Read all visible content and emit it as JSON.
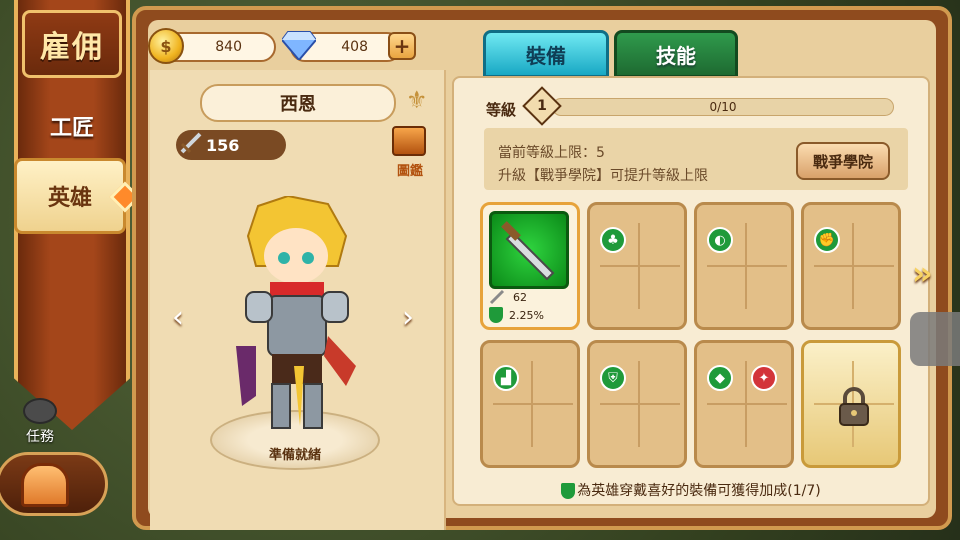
{
  "left_nav": {
    "title": "雇佣",
    "items": [
      {
        "label": "工匠"
      },
      {
        "label": "英雄"
      }
    ],
    "mission_label": "任務"
  },
  "currency": {
    "gold": "840",
    "gems": "408"
  },
  "hero": {
    "name": "西恩",
    "power": "156",
    "codex_label": "圖鑑",
    "status": "準備就緒"
  },
  "tabs": [
    {
      "label": "裝備"
    },
    {
      "label": "技能"
    }
  ],
  "level": {
    "label": "等級",
    "value": "1",
    "progress_text": "0/10",
    "progress_fraction": 0.0
  },
  "info": {
    "line1": "當前等級上限：5",
    "line2": "升級【戰爭學院】可提升等級上限",
    "button": "戰爭學院"
  },
  "equipped": {
    "attack": "62",
    "bonus": "2.25%"
  },
  "footer": "為英雄穿戴喜好的裝備可獲得加成(1/7)",
  "colors": {
    "accent_tab": "#19a8c4",
    "inactive_tab": "#1e6a31",
    "slot_icon_green": "#1f9a3a",
    "slot_icon_red": "#d3343a"
  }
}
